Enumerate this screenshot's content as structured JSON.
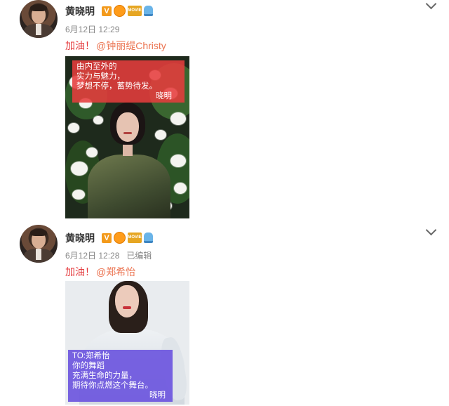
{
  "posts": [
    {
      "author": "黄晓明",
      "badge_v": "V",
      "badge_movie": "MOVIE",
      "date": "6月12日 12:29",
      "edited": "",
      "text": "加油！",
      "mention": "@钟丽缇Christy",
      "photo_caption": [
        "由内至外的",
        "实力与魅力，",
        "梦想不停，蓄势待发。"
      ],
      "photo_signature": "晓明",
      "caption_color": "#e63c3c"
    },
    {
      "author": "黄晓明",
      "badge_v": "V",
      "badge_movie": "MOVIE",
      "date": "6月12日 12:28",
      "edited": "已编辑",
      "text": "加油！",
      "mention": "@郑希怡",
      "photo_caption": [
        "TO:郑希怡",
        "你的舞蹈",
        "充满生命的力量，",
        "期待你点燃这个舞台。"
      ],
      "photo_signature": "晓明",
      "caption_color": "#6c56de"
    }
  ]
}
